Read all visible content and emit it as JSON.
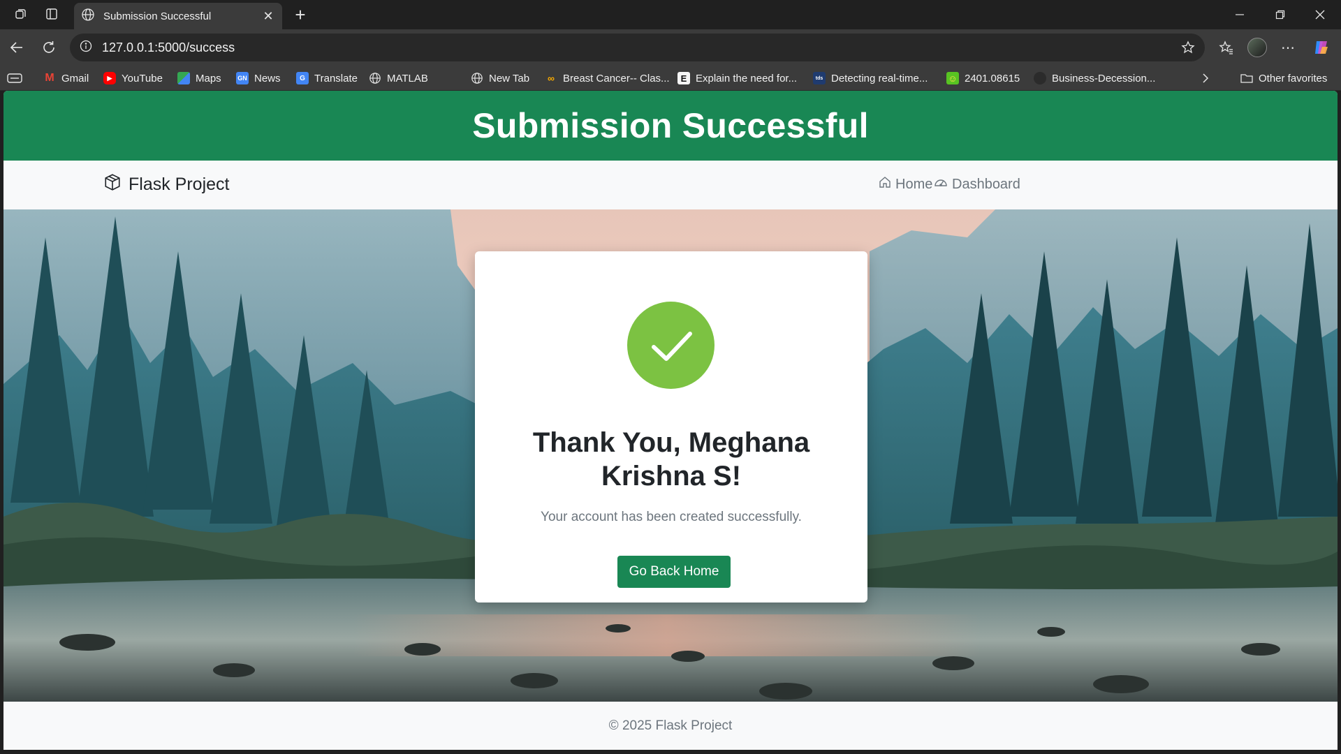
{
  "browser": {
    "tab_title": "Submission Successful",
    "url": "127.0.0.1:5000/success",
    "bookmarks": [
      {
        "label": "Gmail",
        "icon": "gmail-icon"
      },
      {
        "label": "YouTube",
        "icon": "youtube-icon"
      },
      {
        "label": "Maps",
        "icon": "maps-icon"
      },
      {
        "label": "News",
        "icon": "news-icon"
      },
      {
        "label": "Translate",
        "icon": "translate-icon"
      },
      {
        "label": "MATLAB",
        "icon": "globe-icon"
      },
      {
        "label": "",
        "icon": "microsoft-icon"
      },
      {
        "label": "New Tab",
        "icon": "globe-icon"
      },
      {
        "label": "Breast Cancer-- Clas...",
        "icon": "colab-icon"
      },
      {
        "label": "Explain the need for...",
        "icon": "e-icon"
      },
      {
        "label": "Detecting real-time...",
        "icon": "site-icon"
      },
      {
        "label": "2401.08615",
        "icon": "smiley-icon"
      },
      {
        "label": "Business-Decession...",
        "icon": "github-icon"
      }
    ],
    "other_favorites": "Other favorites"
  },
  "page": {
    "header_title": "Submission Successful",
    "brand": "Flask Project",
    "nav": {
      "home": "Home",
      "dashboard": "Dashboard"
    },
    "card": {
      "title": "Thank You, Meghana Krishna S!",
      "message": "Your account has been created successfully.",
      "button": "Go Back Home"
    },
    "footer": "© 2025 Flask Project"
  },
  "colors": {
    "primary_green": "#198754",
    "check_green": "#7cc242"
  }
}
